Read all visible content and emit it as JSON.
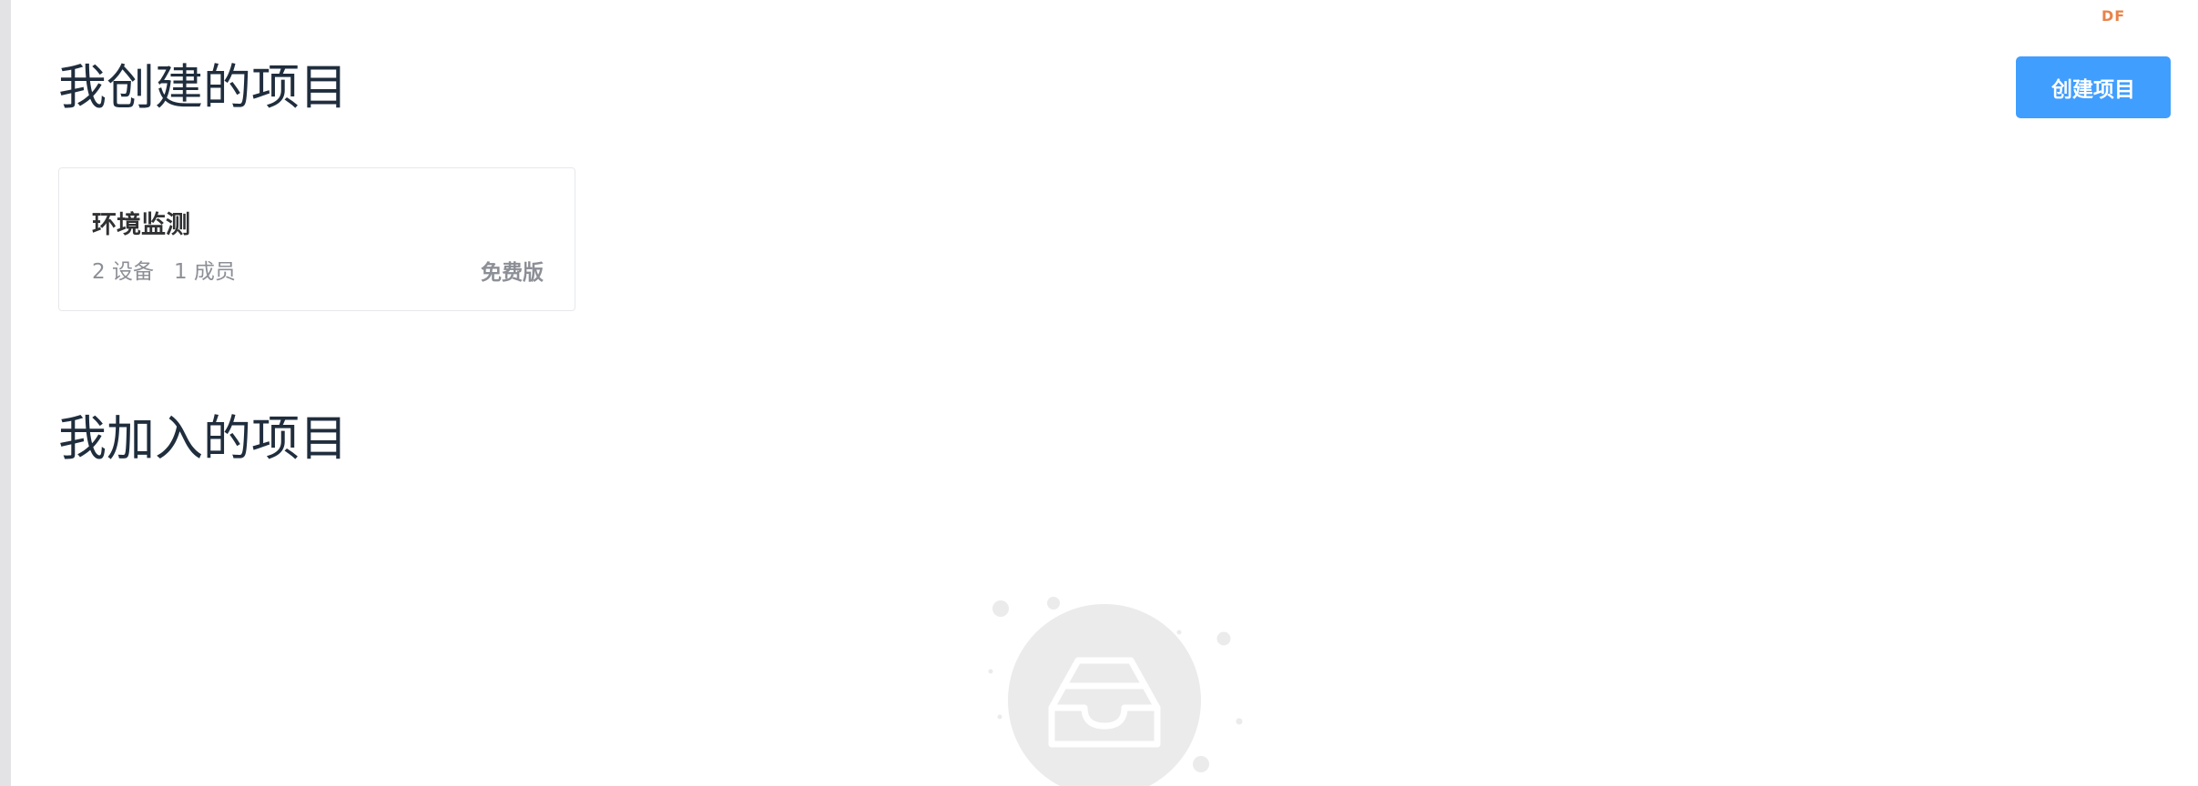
{
  "brand": {
    "mark": "DF",
    "color": "#e8834a"
  },
  "created_section": {
    "title": "我创建的项目",
    "create_button_label": "创建项目",
    "projects": [
      {
        "name": "环境监测",
        "devices": "2 设备",
        "members": "1 成员",
        "plan": "免费版"
      }
    ]
  },
  "joined_section": {
    "title": "我加入的项目",
    "empty_icon": "inbox-tray-icon"
  },
  "colors": {
    "accent": "#409eff",
    "title_text": "#1f2d3d",
    "muted_text": "#8c8f96",
    "empty_illustration": "#ebebeb"
  }
}
